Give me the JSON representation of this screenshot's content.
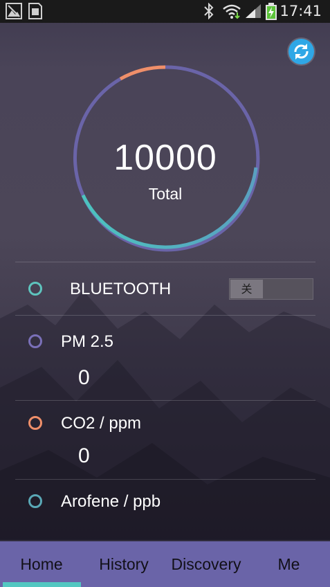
{
  "status_bar": {
    "time": "17:41",
    "icons": [
      "image-notification-icon",
      "sd-card-icon",
      "bluetooth-icon",
      "wifi-icon",
      "signal-icon",
      "battery-charging-icon"
    ]
  },
  "header": {
    "refresh_icon": "refresh-icon"
  },
  "gauge": {
    "value": "10000",
    "label": "Total",
    "colors": {
      "track": "#6a64a8",
      "accent_orange": "#ef8f6a",
      "accent_teal": "#4cc3bf"
    }
  },
  "rows": [
    {
      "label": "BLUETOOTH",
      "ring_color": "#5ec4be"
    },
    {
      "label": "PM 2.5",
      "value": "0",
      "ring_color": "#7a70b8"
    },
    {
      "label": "CO2 / ppm",
      "value": "0",
      "ring_color": "#ef8f6a"
    },
    {
      "label": "Arofene / ppb",
      "ring_color": "#5aa8b6"
    }
  ],
  "bluetooth_toggle": {
    "label": "关",
    "state": "off"
  },
  "bottom_nav": {
    "items": [
      {
        "label": "Home",
        "active": true
      },
      {
        "label": "History",
        "active": false
      },
      {
        "label": "Discovery",
        "active": false
      },
      {
        "label": "Me",
        "active": false
      }
    ],
    "background": "#6a64a8",
    "indicator_color": "#53c7c1"
  }
}
